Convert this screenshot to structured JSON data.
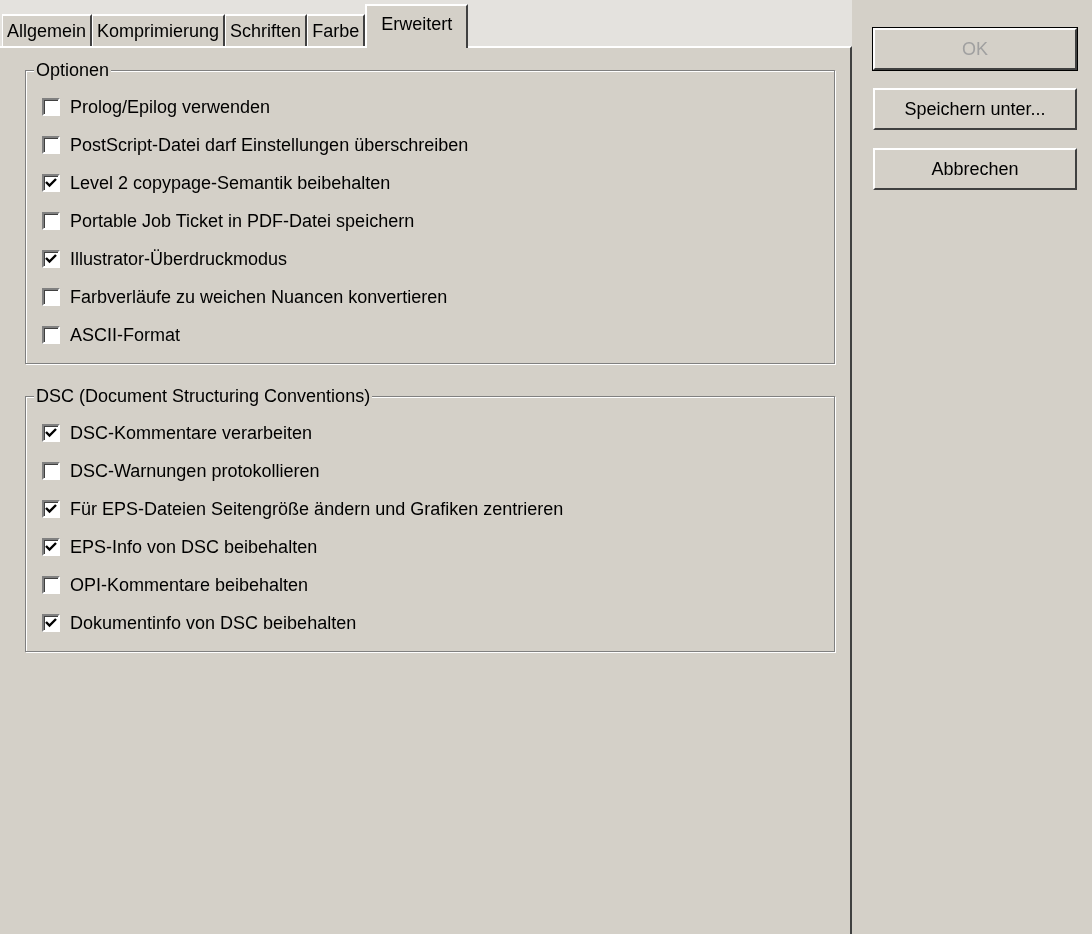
{
  "tabs": [
    {
      "label": "Allgemein",
      "selected": false
    },
    {
      "label": "Komprimierung",
      "selected": false
    },
    {
      "label": "Schriften",
      "selected": false
    },
    {
      "label": "Farbe",
      "selected": false
    },
    {
      "label": "Erweitert",
      "selected": true
    }
  ],
  "groups": [
    {
      "title": "Optionen",
      "options": [
        {
          "label": "Prolog/Epilog verwenden",
          "checked": false
        },
        {
          "label": "PostScript-Datei darf Einstellungen überschreiben",
          "checked": false
        },
        {
          "label": "Level 2 copypage-Semantik beibehalten",
          "checked": true
        },
        {
          "label": "Portable Job Ticket in PDF-Datei speichern",
          "checked": false
        },
        {
          "label": "Illustrator-Überdruckmodus",
          "checked": true
        },
        {
          "label": "Farbverläufe zu weichen Nuancen konvertieren",
          "checked": false
        },
        {
          "label": "ASCII-Format",
          "checked": false
        }
      ]
    },
    {
      "title": "DSC (Document Structuring Conventions)",
      "options": [
        {
          "label": "DSC-Kommentare verarbeiten",
          "checked": true
        },
        {
          "label": "DSC-Warnungen protokollieren",
          "checked": false
        },
        {
          "label": "Für EPS-Dateien Seitengröße ändern und Grafiken zentrieren",
          "checked": true
        },
        {
          "label": "EPS-Info von DSC beibehalten",
          "checked": true
        },
        {
          "label": "OPI-Kommentare beibehalten",
          "checked": false
        },
        {
          "label": "Dokumentinfo von DSC beibehalten",
          "checked": true
        }
      ]
    }
  ],
  "buttons": [
    {
      "label": "OK",
      "disabled": true
    },
    {
      "label": "Speichern unter...",
      "disabled": false
    },
    {
      "label": "Abbrechen",
      "disabled": false
    }
  ]
}
